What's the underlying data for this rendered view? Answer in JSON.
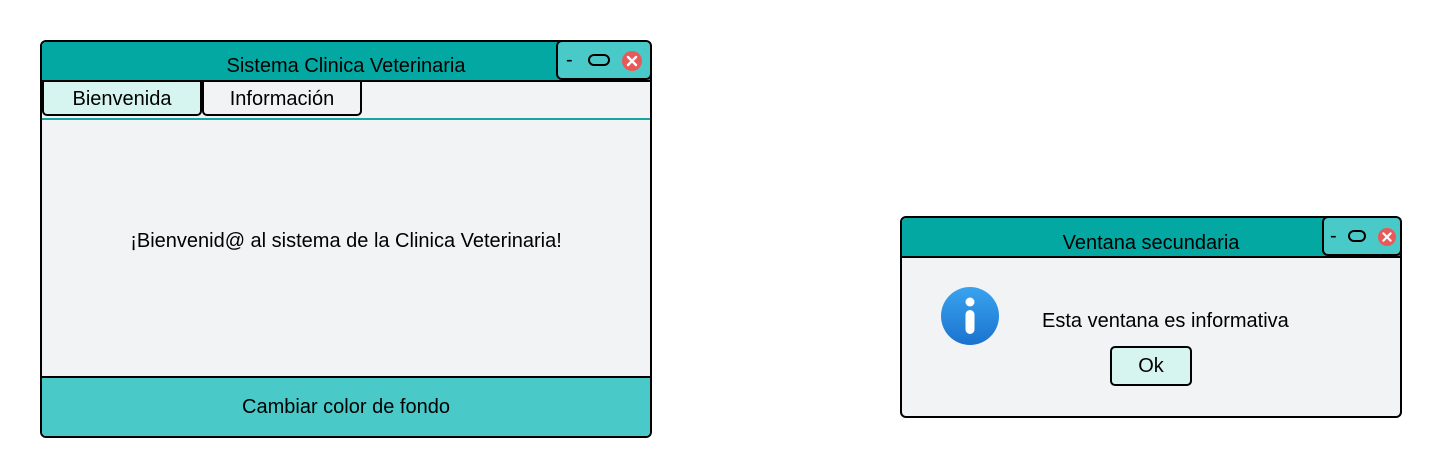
{
  "main_window": {
    "title": "Sistema Clinica Veterinaria",
    "controls": {
      "minimize": "-",
      "maximize_icon": "rounded-rect-icon",
      "close_icon": "close-x-icon"
    },
    "tabs": [
      {
        "label": "Bienvenida",
        "active": true
      },
      {
        "label": "Información",
        "active": false
      }
    ],
    "welcome_text": "¡Bienvenid@ al sistema de la Clinica Veterinaria!",
    "bottom_button_label": "Cambiar color de fondo"
  },
  "secondary_window": {
    "title": "Ventana secundaria",
    "controls": {
      "minimize": "-",
      "maximize_icon": "rounded-rect-icon",
      "close_icon": "close-x-icon"
    },
    "icon": "info-icon",
    "message": "Esta ventana es informativa",
    "ok_label": "Ok"
  },
  "colors": {
    "title_bar": "#04a8a2",
    "controls_bg": "#4ac9c9",
    "active_tab": "#d6f5f1",
    "window_bg": "#f2f3f5",
    "close_red": "#e85a5a",
    "info_blue": "#1f86db"
  }
}
